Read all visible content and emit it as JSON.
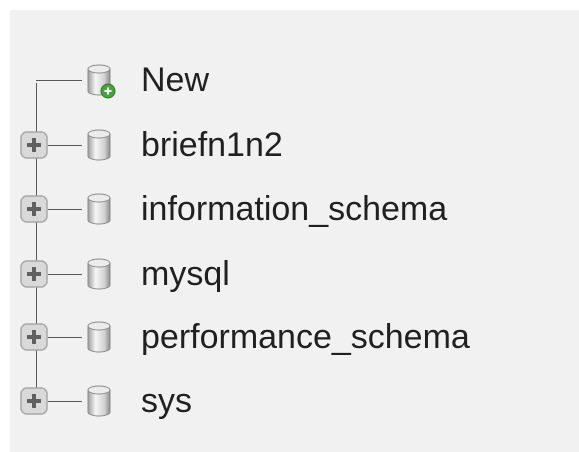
{
  "tree": {
    "new_item": {
      "label": "New",
      "icon": "database-new-icon"
    },
    "databases": [
      {
        "label": "briefn1n2",
        "icon": "database-icon",
        "expander": "plus-icon"
      },
      {
        "label": "information_schema",
        "icon": "database-icon",
        "expander": "plus-icon"
      },
      {
        "label": "mysql",
        "icon": "database-icon",
        "expander": "plus-icon"
      },
      {
        "label": "performance_schema",
        "icon": "database-icon",
        "expander": "plus-icon"
      },
      {
        "label": "sys",
        "icon": "database-icon",
        "expander": "plus-icon"
      }
    ]
  },
  "colors": {
    "panel_bg": "#f1f1f1",
    "text": "#202020",
    "tree_line": "#5a5a5a",
    "expander_bg": "#d9d9d9",
    "expander_border": "#a8a8a8",
    "new_badge": "#45a43a"
  }
}
